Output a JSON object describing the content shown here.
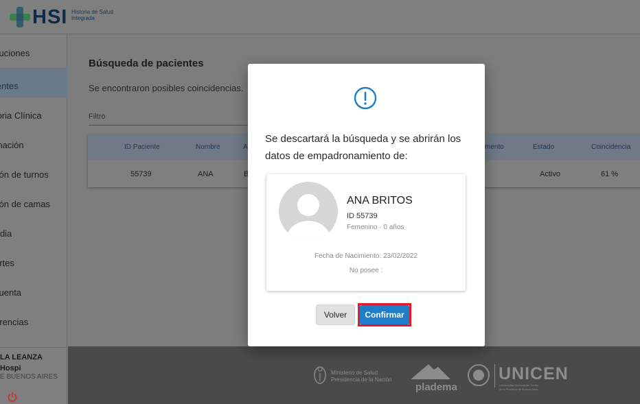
{
  "header": {
    "logo_text": "HSI",
    "logo_subtitle": "Historia de Salud Integrada"
  },
  "sidebar": {
    "items": [
      {
        "label": "ituciones"
      },
      {
        "label": "ientes"
      },
      {
        "label": "toria Clínica"
      },
      {
        "label": "rnación"
      },
      {
        "label": "tión de turnos"
      },
      {
        "label": "tión de camas"
      },
      {
        "label": "ırdia"
      },
      {
        "label": "ortes"
      },
      {
        "label": "cuenta"
      },
      {
        "label": "erencias"
      }
    ],
    "user": {
      "name": "LA LEANZA",
      "institution": "Hospi",
      "province": "E BUENOS AIRES"
    }
  },
  "main": {
    "title": "Búsqueda de pacientes",
    "subtitle": "Se encontraron posibles coincidencias.",
    "filter_label": "Filtro",
    "table": {
      "headers": [
        "ID Paciente",
        "Nombre",
        "A",
        "mento",
        "Estado",
        "Coincidencia"
      ],
      "rows": [
        {
          "id": "55739",
          "nombre": "ANA",
          "apellido": "B",
          "estado": "Activo",
          "coincidencia": "61 %"
        }
      ]
    }
  },
  "footer": {
    "ministry_line1": "Ministerio de Salud",
    "ministry_line2": "Presidencia de la Nación",
    "pladema": "pladema",
    "unicen": "UNICEN",
    "unicen_sub1": "Universidad Nacional del Centro",
    "unicen_sub2": "de la Provincia de Buenos Aires"
  },
  "modal": {
    "message": "Se descartará la búsqueda y se abrirán los datos de empadronamiento de:",
    "patient": {
      "name": "ANA BRITOS",
      "id": "ID 55739",
      "gender_age": "Femenino · 0 años",
      "birth": "Fecha de Nacimiento: 23/02/2022",
      "extra": "No posee :"
    },
    "cancel_label": "Volver",
    "confirm_label": "Confirmar"
  },
  "colors": {
    "accent": "#1e7dc8",
    "highlight": "#e21a2c",
    "overlay": "#7d7d7d"
  }
}
